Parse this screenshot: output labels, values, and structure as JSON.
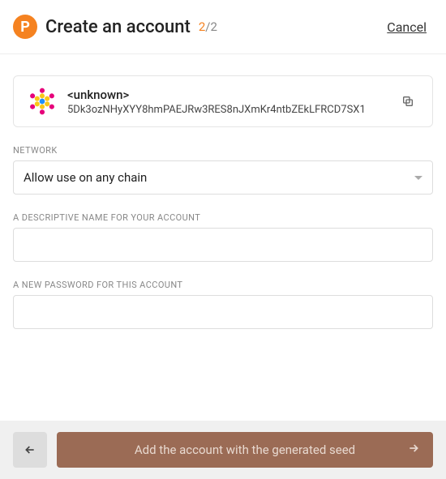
{
  "header": {
    "title": "Create an account",
    "step_current": "2",
    "step_total": "/2",
    "cancel": "Cancel"
  },
  "account": {
    "name": "<unknown>",
    "address": "5Dk3ozNHyXYY8hmPAEJRw3RES8nJXmKr4ntbZEkLFRCD7SX1"
  },
  "labels": {
    "network": "NETWORK",
    "descriptive_name": "A DESCRIPTIVE NAME FOR YOUR ACCOUNT",
    "password": "A NEW PASSWORD FOR THIS ACCOUNT"
  },
  "network": {
    "selected": "Allow use on any chain"
  },
  "inputs": {
    "name_value": "",
    "password_value": ""
  },
  "footer": {
    "primary": "Add the account with the generated seed"
  }
}
